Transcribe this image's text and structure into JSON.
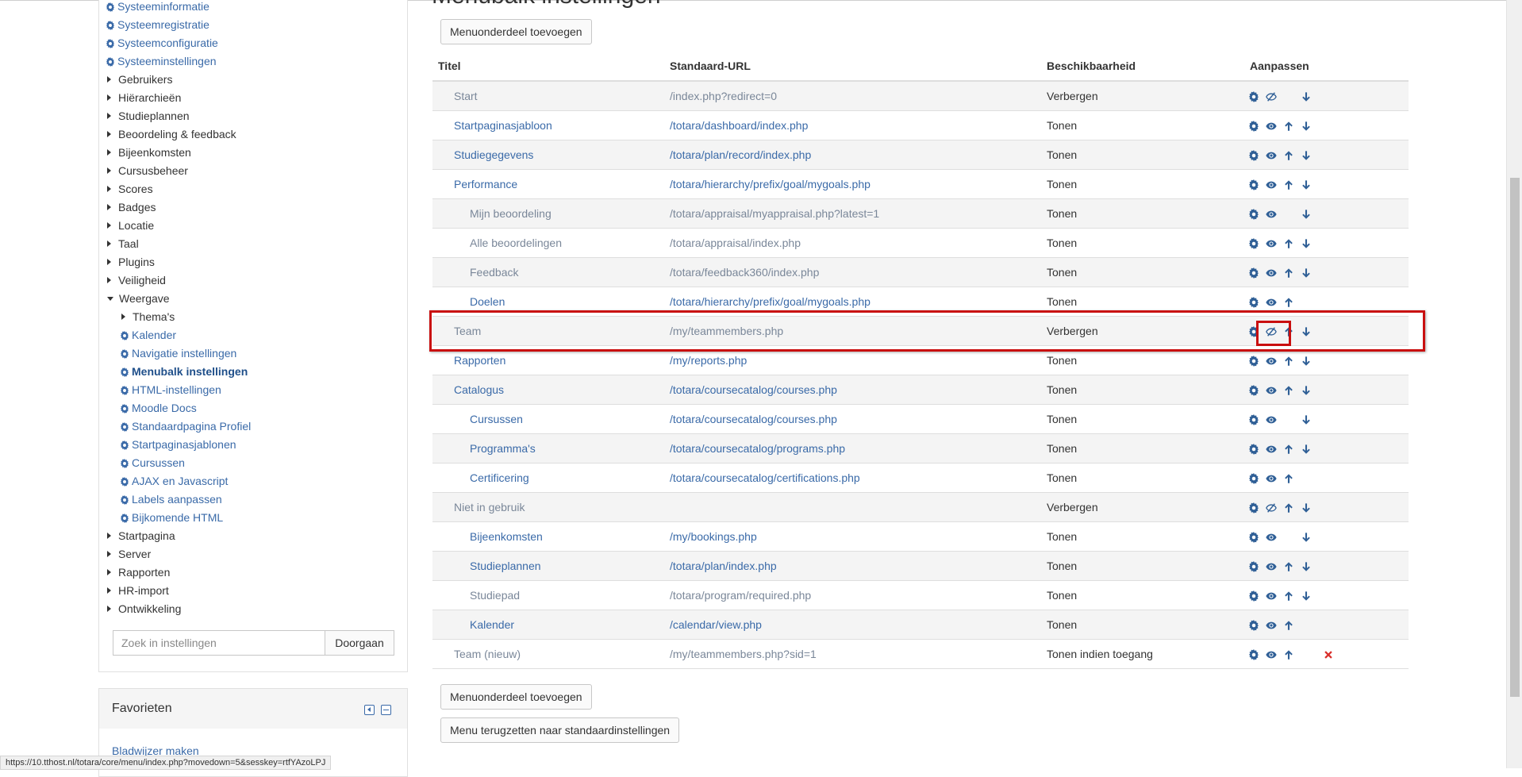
{
  "sidebar": {
    "items": [
      {
        "label": "Systeeminformatie",
        "type": "leaf",
        "level": 1
      },
      {
        "label": "Systeemregistratie",
        "type": "leaf",
        "level": 1
      },
      {
        "label": "Systeemconfiguratie",
        "type": "leaf",
        "level": 1
      },
      {
        "label": "Systeeminstellingen",
        "type": "leaf",
        "level": 1
      },
      {
        "label": "Gebruikers",
        "type": "collapsed",
        "level": 1
      },
      {
        "label": "Hiërarchieën",
        "type": "collapsed",
        "level": 1
      },
      {
        "label": "Studieplannen",
        "type": "collapsed",
        "level": 1
      },
      {
        "label": "Beoordeling & feedback",
        "type": "collapsed",
        "level": 1
      },
      {
        "label": "Bijeenkomsten",
        "type": "collapsed",
        "level": 1
      },
      {
        "label": "Cursusbeheer",
        "type": "collapsed",
        "level": 1
      },
      {
        "label": "Scores",
        "type": "collapsed",
        "level": 1
      },
      {
        "label": "Badges",
        "type": "collapsed",
        "level": 1
      },
      {
        "label": "Locatie",
        "type": "collapsed",
        "level": 1
      },
      {
        "label": "Taal",
        "type": "collapsed",
        "level": 1
      },
      {
        "label": "Plugins",
        "type": "collapsed",
        "level": 1
      },
      {
        "label": "Veiligheid",
        "type": "collapsed",
        "level": 1
      },
      {
        "label": "Weergave",
        "type": "expanded",
        "level": 1
      },
      {
        "label": "Thema's",
        "type": "collapsed",
        "level": 2
      },
      {
        "label": "Kalender",
        "type": "leaf",
        "level": 2
      },
      {
        "label": "Navigatie instellingen",
        "type": "leaf",
        "level": 2
      },
      {
        "label": "Menubalk instellingen",
        "type": "current",
        "level": 2
      },
      {
        "label": "HTML-instellingen",
        "type": "leaf",
        "level": 2
      },
      {
        "label": "Moodle Docs",
        "type": "leaf",
        "level": 2
      },
      {
        "label": "Standaardpagina Profiel",
        "type": "leaf",
        "level": 2
      },
      {
        "label": "Startpaginasjablonen",
        "type": "leaf",
        "level": 2
      },
      {
        "label": "Cursussen",
        "type": "leaf",
        "level": 2
      },
      {
        "label": "AJAX en Javascript",
        "type": "leaf",
        "level": 2
      },
      {
        "label": "Labels aanpassen",
        "type": "leaf",
        "level": 2
      },
      {
        "label": "Bijkomende HTML",
        "type": "leaf",
        "level": 2
      },
      {
        "label": "Startpagina",
        "type": "collapsed",
        "level": 1
      },
      {
        "label": "Server",
        "type": "collapsed",
        "level": 1
      },
      {
        "label": "Rapporten",
        "type": "collapsed",
        "level": 1
      },
      {
        "label": "HR-import",
        "type": "collapsed",
        "level": 1
      },
      {
        "label": "Ontwikkeling",
        "type": "collapsed",
        "level": 1
      }
    ],
    "search": {
      "placeholder": "Zoek in instellingen",
      "button": "Doorgaan"
    }
  },
  "favorites": {
    "title": "Favorieten",
    "link": "Bladwijzer maken"
  },
  "statusbar": {
    "url": "https://10.tthost.nl/totara/core/menu/index.php?movedown=5&sesskey=rtfYAzoLPJ"
  },
  "main": {
    "title": "Menubalk instellingen",
    "add_button": "Menuonderdeel toevoegen",
    "add_button_bottom": "Menuonderdeel toevoegen",
    "reset_button": "Menu terugzetten naar standaardinstellingen",
    "columns": {
      "title": "Titel",
      "url": "Standaard-URL",
      "availability": "Beschikbaarheid",
      "edit": "Aanpassen"
    },
    "rows": [
      {
        "title": "Start",
        "url": "/index.php?redirect=0",
        "avail": "Verbergen",
        "indent": 0,
        "hidden": true,
        "icons": [
          "gear",
          "eye-off",
          "",
          "down"
        ]
      },
      {
        "title": "Startpaginasjabloon",
        "url": "/totara/dashboard/index.php",
        "avail": "Tonen",
        "indent": 0,
        "hidden": false,
        "icons": [
          "gear",
          "eye",
          "up",
          "down"
        ]
      },
      {
        "title": "Studiegegevens",
        "url": "/totara/plan/record/index.php",
        "avail": "Tonen",
        "indent": 0,
        "hidden": false,
        "icons": [
          "gear",
          "eye",
          "up",
          "down"
        ]
      },
      {
        "title": "Performance",
        "url": "/totara/hierarchy/prefix/goal/mygoals.php",
        "avail": "Tonen",
        "indent": 0,
        "hidden": false,
        "icons": [
          "gear",
          "eye",
          "up",
          "down"
        ]
      },
      {
        "title": "Mijn beoordeling",
        "url": "/totara/appraisal/myappraisal.php?latest=1",
        "avail": "Tonen",
        "indent": 1,
        "hidden": true,
        "icons": [
          "gear",
          "eye",
          "",
          "down"
        ]
      },
      {
        "title": "Alle beoordelingen",
        "url": "/totara/appraisal/index.php",
        "avail": "Tonen",
        "indent": 1,
        "hidden": true,
        "icons": [
          "gear",
          "eye",
          "up",
          "down"
        ]
      },
      {
        "title": "Feedback",
        "url": "/totara/feedback360/index.php",
        "avail": "Tonen",
        "indent": 1,
        "hidden": true,
        "icons": [
          "gear",
          "eye",
          "up",
          "down"
        ]
      },
      {
        "title": "Doelen",
        "url": "/totara/hierarchy/prefix/goal/mygoals.php",
        "avail": "Tonen",
        "indent": 1,
        "hidden": false,
        "icons": [
          "gear",
          "eye",
          "up",
          ""
        ]
      },
      {
        "title": "Team",
        "url": "/my/teammembers.php",
        "avail": "Verbergen",
        "indent": 0,
        "hidden": true,
        "icons": [
          "gear",
          "eye-off",
          "up",
          "down"
        ]
      },
      {
        "title": "Rapporten",
        "url": "/my/reports.php",
        "avail": "Tonen",
        "indent": 0,
        "hidden": false,
        "icons": [
          "gear",
          "eye",
          "up",
          "down"
        ]
      },
      {
        "title": "Catalogus",
        "url": "/totara/coursecatalog/courses.php",
        "avail": "Tonen",
        "indent": 0,
        "hidden": false,
        "icons": [
          "gear",
          "eye",
          "up",
          "down"
        ]
      },
      {
        "title": "Cursussen",
        "url": "/totara/coursecatalog/courses.php",
        "avail": "Tonen",
        "indent": 1,
        "hidden": false,
        "icons": [
          "gear",
          "eye",
          "",
          "down"
        ]
      },
      {
        "title": "Programma's",
        "url": "/totara/coursecatalog/programs.php",
        "avail": "Tonen",
        "indent": 1,
        "hidden": false,
        "icons": [
          "gear",
          "eye",
          "up",
          "down"
        ]
      },
      {
        "title": "Certificering",
        "url": "/totara/coursecatalog/certifications.php",
        "avail": "Tonen",
        "indent": 1,
        "hidden": false,
        "icons": [
          "gear",
          "eye",
          "up",
          ""
        ]
      },
      {
        "title": "Niet in gebruik",
        "url": "",
        "avail": "Verbergen",
        "indent": 0,
        "hidden": true,
        "icons": [
          "gear",
          "eye-off",
          "up",
          "down"
        ]
      },
      {
        "title": "Bijeenkomsten",
        "url": "/my/bookings.php",
        "avail": "Tonen",
        "indent": 1,
        "hidden": false,
        "icons": [
          "gear",
          "eye",
          "",
          "down"
        ]
      },
      {
        "title": "Studieplannen",
        "url": "/totara/plan/index.php",
        "avail": "Tonen",
        "indent": 1,
        "hidden": false,
        "icons": [
          "gear",
          "eye",
          "up",
          "down"
        ]
      },
      {
        "title": "Studiepad",
        "url": "/totara/program/required.php",
        "avail": "Tonen",
        "indent": 1,
        "hidden": true,
        "icons": [
          "gear",
          "eye",
          "up",
          "down"
        ]
      },
      {
        "title": "Kalender",
        "url": "/calendar/view.php",
        "avail": "Tonen",
        "indent": 1,
        "hidden": false,
        "icons": [
          "gear",
          "eye",
          "up",
          ""
        ]
      },
      {
        "title": "Team (nieuw)",
        "url": "/my/teammembers.php?sid=1",
        "avail": "Tonen indien toegang",
        "indent": 0,
        "hidden": true,
        "icons": [
          "gear",
          "eye",
          "up",
          "",
          "delete"
        ]
      }
    ]
  },
  "colors": {
    "link": "#3a6aa8",
    "hidden_text": "#7a8799",
    "icon": "#2f5f96",
    "delete": "#d9302c",
    "highlight": "#c90f0f"
  }
}
